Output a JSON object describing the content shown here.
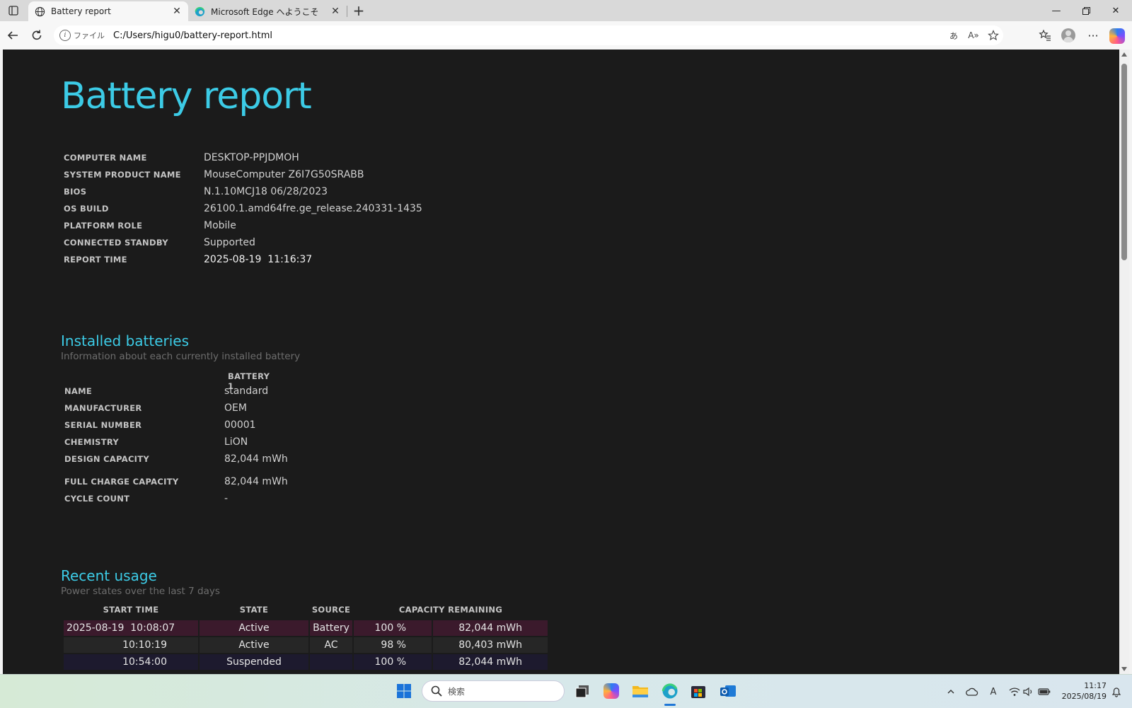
{
  "browser": {
    "tabs": [
      {
        "title": "Battery report",
        "active": true,
        "icon": "globe-icon"
      },
      {
        "title": "Microsoft Edge へようこそ",
        "active": false,
        "icon": "edge-icon"
      }
    ],
    "address": {
      "site_label": "ファイル",
      "url": "C:/Users/higu0/battery-report.html"
    }
  },
  "report": {
    "title": "Battery report",
    "system_info": [
      {
        "label": "COMPUTER NAME",
        "value": "DESKTOP-PPJDMOH"
      },
      {
        "label": "SYSTEM PRODUCT NAME",
        "value": "MouseComputer Z6I7G50SRABB"
      },
      {
        "label": "BIOS",
        "value": "N.1.10MCJ18 06/28/2023"
      },
      {
        "label": "OS BUILD",
        "value": "26100.1.amd64fre.ge_release.240331-1435"
      },
      {
        "label": "PLATFORM ROLE",
        "value": "Mobile"
      },
      {
        "label": "CONNECTED STANDBY",
        "value": "Supported"
      },
      {
        "label": "REPORT TIME",
        "value": "2025-08-19  11:16:37"
      }
    ],
    "installed_batteries": {
      "title": "Installed batteries",
      "subtitle": "Information about each currently installed battery",
      "column_header": "BATTERY 1",
      "rows": [
        {
          "label": "NAME",
          "value": "standard"
        },
        {
          "label": "MANUFACTURER",
          "value": "OEM"
        },
        {
          "label": "SERIAL NUMBER",
          "value": "00001"
        },
        {
          "label": "CHEMISTRY",
          "value": "LiON"
        },
        {
          "label": "DESIGN CAPACITY",
          "value": "82,044 mWh"
        },
        {
          "label": "FULL CHARGE CAPACITY",
          "value": "82,044 mWh"
        },
        {
          "label": "CYCLE COUNT",
          "value": "-"
        }
      ]
    },
    "recent_usage": {
      "title": "Recent usage",
      "subtitle": "Power states over the last 7 days",
      "headers": {
        "start_time": "START TIME",
        "state": "STATE",
        "source": "SOURCE",
        "capacity": "CAPACITY REMAINING"
      },
      "rows": [
        {
          "start_time": "2025-08-19  10:08:07",
          "state": "Active",
          "source": "Battery",
          "percent": "100 %",
          "mwh": "82,044 mWh"
        },
        {
          "start_time": "10:10:19",
          "state": "Active",
          "source": "AC",
          "percent": "98 %",
          "mwh": "80,403 mWh"
        },
        {
          "start_time": "10:54:00",
          "state": "Suspended",
          "source": "",
          "percent": "100 %",
          "mwh": "82,044 mWh"
        }
      ]
    }
  },
  "taskbar": {
    "search_placeholder": "検索",
    "time": "11:17",
    "date": "2025/08/19",
    "ime_indicator": "A"
  }
}
